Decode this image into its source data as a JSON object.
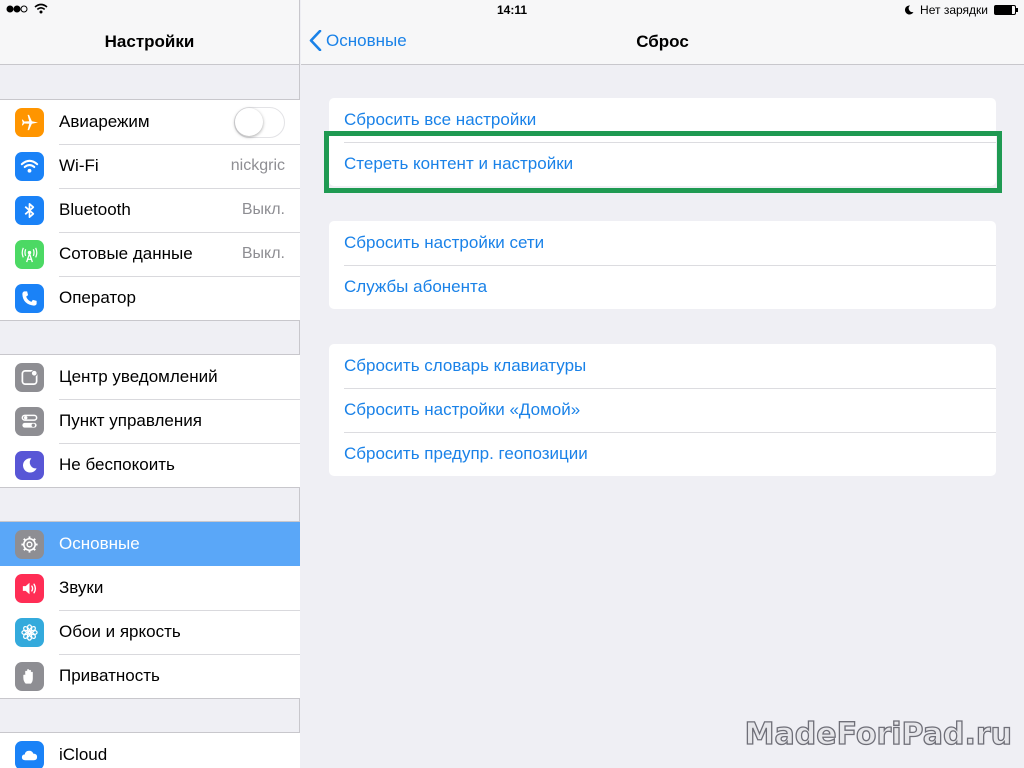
{
  "status_bar": {
    "time": "14:11",
    "charging_text": "Нет зарядки",
    "battery_level": 0.85
  },
  "master": {
    "title": "Настройки",
    "groups": [
      [
        {
          "label": "Авиарежим",
          "icon": "airplane-icon",
          "color": "#ff9500",
          "toggle": false
        },
        {
          "label": "Wi-Fi",
          "icon": "wifi-icon",
          "color": "#1a82f7",
          "value": "nickgric"
        },
        {
          "label": "Bluetooth",
          "icon": "bluetooth-icon",
          "color": "#1a82f7",
          "value": "Выкл."
        },
        {
          "label": "Сотовые данные",
          "icon": "antenna-icon",
          "color": "#4cd964",
          "value": "Выкл."
        },
        {
          "label": "Оператор",
          "icon": "phone-icon",
          "color": "#1a82f7"
        }
      ],
      [
        {
          "label": "Центр уведомлений",
          "icon": "notifications-icon",
          "color": "#8e8e93"
        },
        {
          "label": "Пункт управления",
          "icon": "control-center-icon",
          "color": "#8e8e93"
        },
        {
          "label": "Не беспокоить",
          "icon": "moon-icon",
          "color": "#5856d6"
        }
      ],
      [
        {
          "label": "Основные",
          "icon": "gear-icon",
          "color": "#8e8e93",
          "selected": true
        },
        {
          "label": "Звуки",
          "icon": "speaker-icon",
          "color": "#ff2d55"
        },
        {
          "label": "Обои и яркость",
          "icon": "flower-icon",
          "color": "#34aadc"
        },
        {
          "label": "Приватность",
          "icon": "hand-icon",
          "color": "#8e8e93"
        }
      ],
      [
        {
          "label": "iCloud",
          "icon": "cloud-icon",
          "color": "#1a82f7"
        }
      ]
    ]
  },
  "detail": {
    "back_label": "Основные",
    "title": "Сброс",
    "sections": [
      [
        "Сбросить все настройки",
        "Стереть контент и настройки"
      ],
      [
        "Сбросить настройки сети",
        "Службы абонента"
      ],
      [
        "Сбросить словарь клавиатуры",
        "Сбросить настройки «Домой»",
        "Сбросить предупр. геопозиции"
      ]
    ]
  },
  "watermark": "MadeForiPad.ru",
  "colors": {
    "accent": "#1a82e8",
    "selected": "#5aa7f8",
    "highlight": "#1f9a52"
  }
}
